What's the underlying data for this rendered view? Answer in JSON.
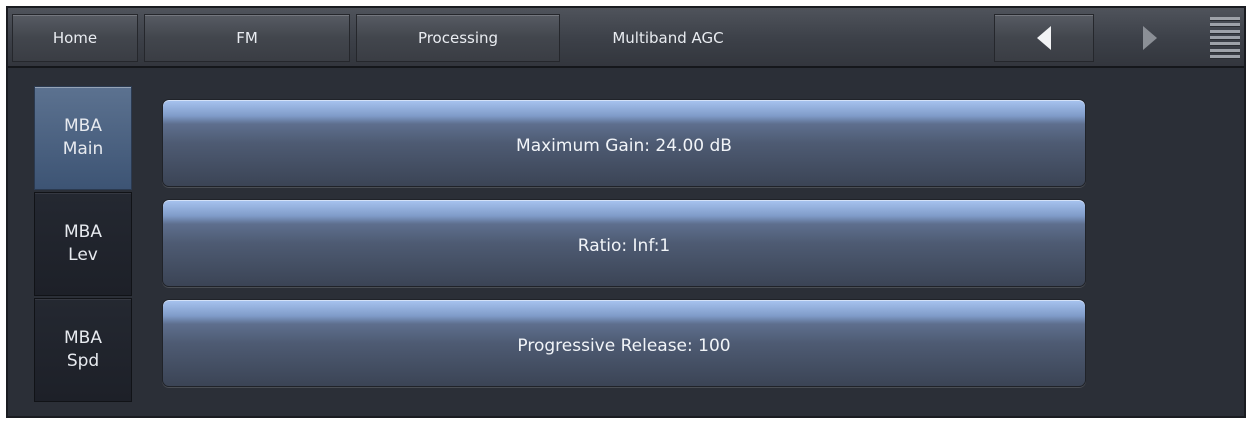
{
  "toolbar": {
    "home_label": "Home",
    "fm_label": "FM",
    "processing_label": "Processing",
    "page_title": "Multiband AGC",
    "back_icon": "left-triangle-icon",
    "forward_icon": "right-triangle-icon",
    "menu_icon": "hamburger-menu-icon"
  },
  "side_tabs": [
    {
      "line1": "MBA",
      "line2": "Main",
      "active": true
    },
    {
      "line1": "MBA",
      "line2": "Lev",
      "active": false
    },
    {
      "line1": "MBA",
      "line2": "Spd",
      "active": false
    }
  ],
  "params": [
    {
      "label": "Maximum Gain: 24.00 dB"
    },
    {
      "label": "Ratio: Inf:1"
    },
    {
      "label": "Progressive Release: 100"
    }
  ],
  "colors": {
    "background": "#2b2f37",
    "active_tab": "#4a6080",
    "param_highlight": "#a8c4f0"
  }
}
